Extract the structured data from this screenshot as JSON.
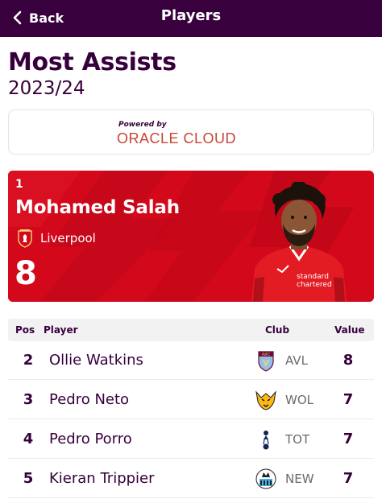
{
  "topbar": {
    "back_label": "Back",
    "title": "Players",
    "color": "#38003c"
  },
  "page": {
    "title": "Most Assists",
    "season": "2023/24"
  },
  "sponsor": {
    "powered_by": "Powered by",
    "brand": "ORACLE CLOUD",
    "brand_color": "#c74634"
  },
  "leader": {
    "pos": "1",
    "name": "Mohamed Salah",
    "club": "Liverpool",
    "value": "8",
    "crest_icon": "liverpool-crest-icon",
    "card_color": "#d3091b"
  },
  "table": {
    "headers": {
      "pos": "Pos",
      "player": "Player",
      "club": "Club",
      "value": "Value"
    },
    "rows": [
      {
        "pos": "2",
        "name": "Ollie Watkins",
        "club": "AVL",
        "value": "8",
        "crest_icon": "aston-villa-crest-icon"
      },
      {
        "pos": "3",
        "name": "Pedro Neto",
        "club": "WOL",
        "value": "7",
        "crest_icon": "wolves-crest-icon"
      },
      {
        "pos": "4",
        "name": "Pedro Porro",
        "club": "TOT",
        "value": "7",
        "crest_icon": "tottenham-crest-icon"
      },
      {
        "pos": "5",
        "name": "Kieran Trippier",
        "club": "NEW",
        "value": "7",
        "crest_icon": "newcastle-crest-icon"
      }
    ]
  }
}
